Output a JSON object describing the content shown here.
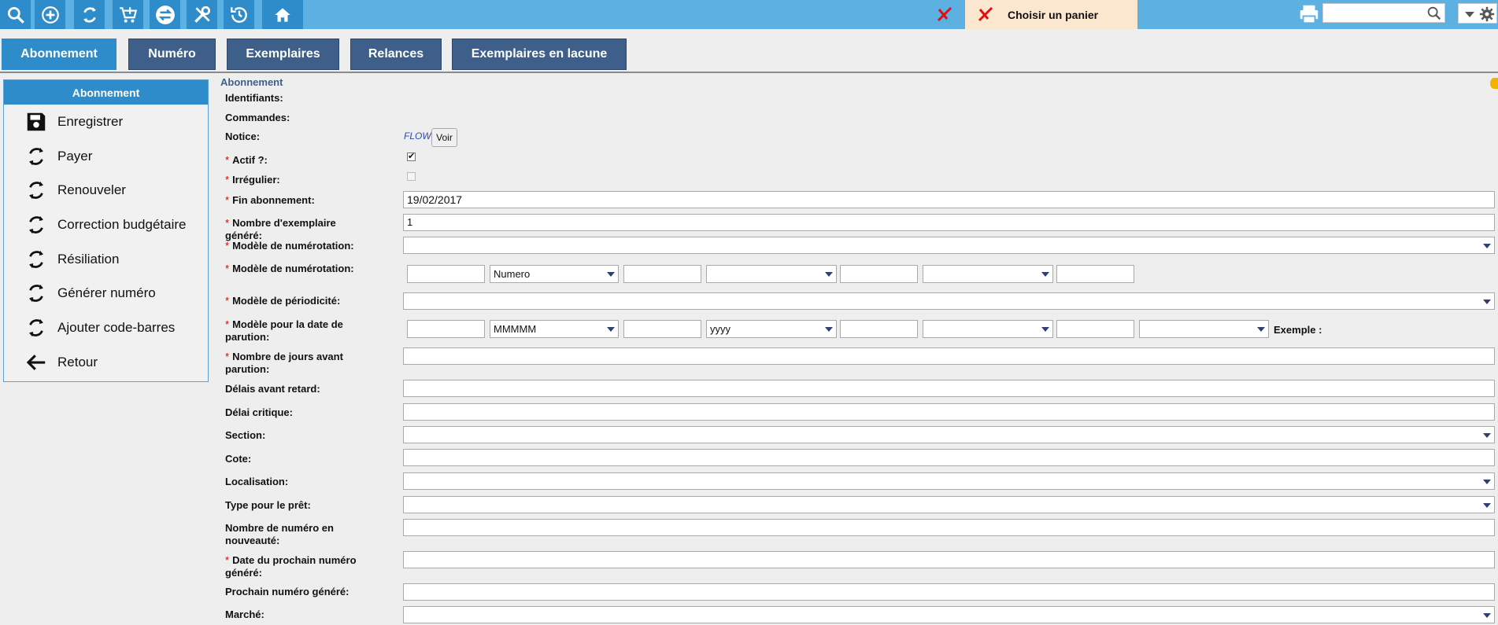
{
  "toolbar": {
    "cart_label": "Choisir un panier",
    "search_placeholder": ""
  },
  "tabs": [
    "Abonnement",
    "Numéro",
    "Exemplaires",
    "Relances",
    "Exemplaires en lacune"
  ],
  "leftmenu": {
    "title": "Abonnement",
    "items": [
      "Enregistrer",
      "Payer",
      "Renouveler",
      "Correction budgétaire",
      "Résiliation",
      "Générer numéro",
      "Ajouter code-barres",
      "Retour"
    ]
  },
  "form": {
    "section_title": "Abonnement",
    "labels": {
      "identifiants": "Identifiants:",
      "commandes": "Commandes:",
      "notice": "Notice:",
      "actif": "Actif ?:",
      "irregulier": "Irrégulier:",
      "fin_abonnement": "Fin abonnement:",
      "nb_exemplaire": "Nombre d'exemplaire généré:",
      "modele_numerotation_1": "Modèle de numérotation:",
      "modele_numerotation_2": "Modèle de numérotation:",
      "modele_periodicite": "Modèle de périodicité:",
      "modele_date_parution_1": "Modèle pour la date de",
      "modele_date_parution_2": "parution:",
      "nb_jours_1": "Nombre de jours avant",
      "nb_jours_2": "parution:",
      "delais_retard": "Délais avant retard:",
      "delai_critique": "Délai critique:",
      "section": "Section:",
      "cote": "Cote:",
      "localisation": "Localisation:",
      "type_pret": "Type pour le prêt:",
      "nb_nouveaute_1": "Nombre de numéro en",
      "nb_nouveaute_2": "nouveauté:",
      "date_prochain_1": "Date du prochain numéro",
      "date_prochain_2": "généré:",
      "prochain_numero": "Prochain numéro généré:",
      "marche": "Marché:"
    },
    "notice_value": "FLOW",
    "voir_label": "Voir",
    "required_mark": "*",
    "actif_checked": true,
    "irregulier_checked": false,
    "checkmark": "✔",
    "fin_abonnement_value": "19/02/2017",
    "nb_exemplaire_value": "1",
    "numerotation_select_value": "Numero",
    "date_select_1_value": "MMMMM",
    "date_select_2_value": "yyyy",
    "exemple_label": "Exemple :"
  }
}
